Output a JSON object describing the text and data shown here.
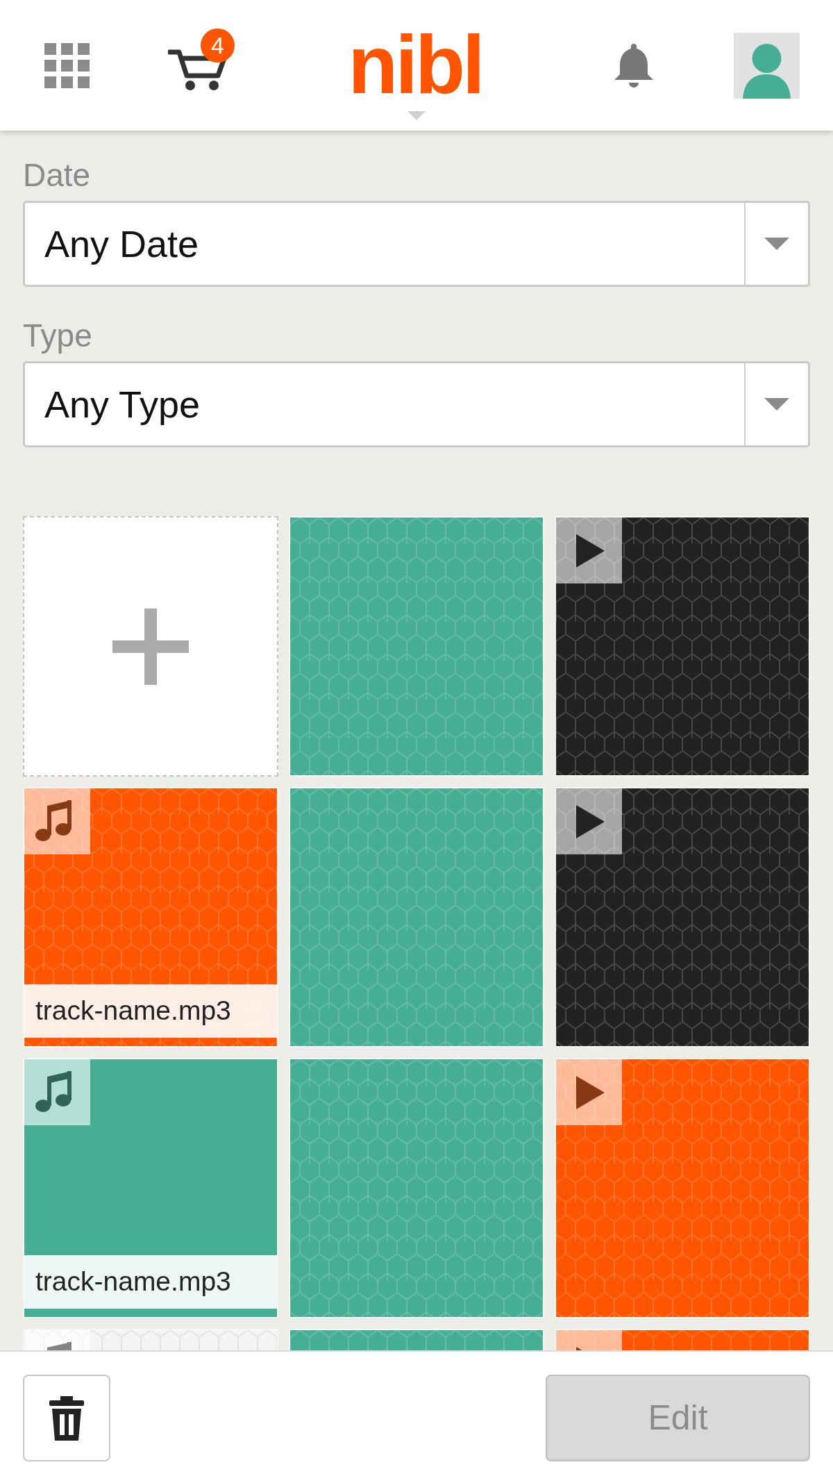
{
  "header": {
    "logo": "nibl",
    "cart_count": "4"
  },
  "filters": [
    {
      "label": "Date",
      "value": "Any Date"
    },
    {
      "label": "Type",
      "value": "Any Type"
    }
  ],
  "tiles": [
    {
      "kind": "add"
    },
    {
      "kind": "image",
      "color": "#45ae94",
      "patterned": true
    },
    {
      "kind": "video",
      "color": "#222222",
      "patterned": true
    },
    {
      "kind": "audio",
      "color": "#ff5500",
      "patterned": true,
      "caption": "track-name.mp3"
    },
    {
      "kind": "image",
      "color": "#45ae94",
      "patterned": true
    },
    {
      "kind": "video",
      "color": "#222222",
      "patterned": true
    },
    {
      "kind": "audio",
      "color": "#45ae94",
      "patterned": false,
      "caption": "track-name.mp3"
    },
    {
      "kind": "image",
      "color": "#45ae94",
      "patterned": true
    },
    {
      "kind": "video",
      "color": "#ff5500",
      "patterned": true
    },
    {
      "kind": "audio",
      "color": "#f4f4f4",
      "patterned": true
    },
    {
      "kind": "image",
      "color": "#45ae94",
      "patterned": true
    },
    {
      "kind": "video",
      "color": "#ff5500",
      "patterned": true
    }
  ],
  "footer": {
    "edit_button": {
      "label": "Edit",
      "disabled": true
    }
  }
}
